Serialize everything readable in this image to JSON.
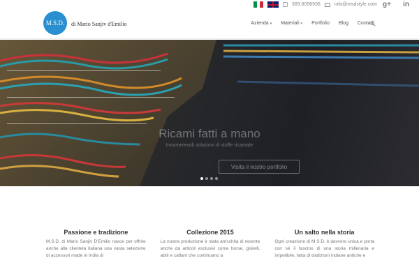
{
  "topbar": {
    "phone": "389.8096936",
    "email": "info@msdstyle.com",
    "social": [
      "g+",
      "in"
    ]
  },
  "header": {
    "logo_text": "M.S.D.",
    "brand_text": "di Mario Sanjiv d'Emilio",
    "nav": [
      {
        "label": "Azienda",
        "has_dropdown": true
      },
      {
        "label": "Materiali",
        "has_dropdown": true
      },
      {
        "label": "Portfolio",
        "has_dropdown": false
      },
      {
        "label": "Blog",
        "has_dropdown": false
      },
      {
        "label": "Contatti",
        "has_dropdown": false
      }
    ]
  },
  "hero": {
    "title": "Ricami fatti a mano",
    "subtitle": "Innumerevoli soluzioni di stoffe ricamate",
    "button_label": "Visita il nostro portfolio",
    "slides": 4,
    "active_slide": 1
  },
  "columns": [
    {
      "title": "Passione e tradizione",
      "text": "M.S.D. di Mario Sanjiv D'Emilio nasce per offrire anche alla clientela italiana una vasta selezione di accessori made in India di"
    },
    {
      "title": "Collezione 2015",
      "text": "La nostra produzione è stata arricchita di recente anche da articoli esclusivi come borse, gioielli, abiti e caftani che continuano a"
    },
    {
      "title": "Un salto nella storia",
      "text": "Ogni creazione di M.S.D. è davvero unica e porta con sé il fascino di una storia millenaria e irripetibile, fatta di tradizioni indiane antiche e"
    }
  ],
  "colors": {
    "brand": "#2a8fd0"
  }
}
